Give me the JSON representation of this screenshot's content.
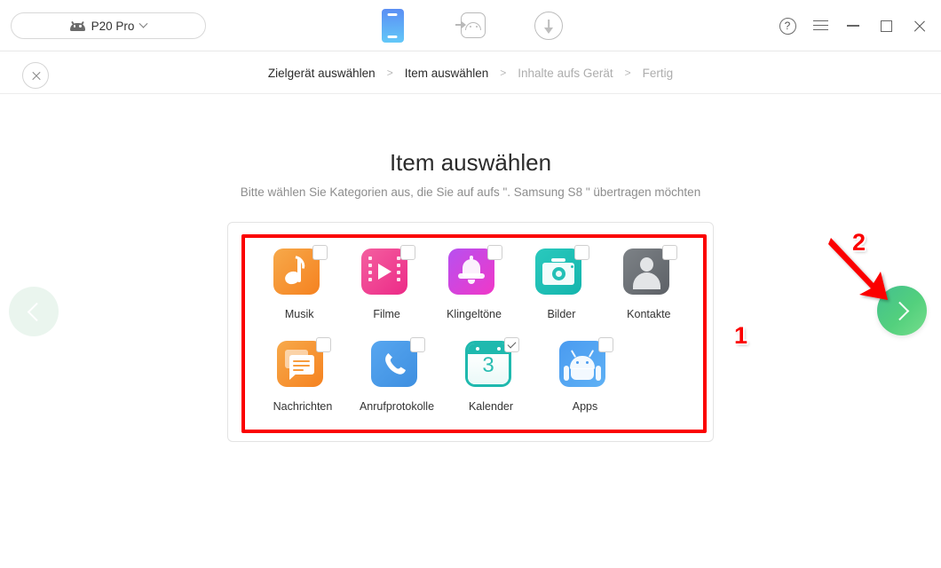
{
  "titlebar": {
    "device": {
      "name": "P20 Pro",
      "icon": "android-head-icon",
      "chevron": "chevron-down-icon"
    },
    "tools": [
      {
        "name": "phone-transfer-tool",
        "icon": "phone-icon",
        "active": true
      },
      {
        "name": "android-restore-tool",
        "icon": "android-transfer-icon",
        "active": false
      },
      {
        "name": "download-tool",
        "icon": "download-circle-icon",
        "active": false
      }
    ],
    "window_controls": [
      {
        "name": "help-button",
        "glyph": "?"
      },
      {
        "name": "menu-button",
        "glyph": "≡"
      },
      {
        "name": "minimize-button",
        "glyph": "–"
      },
      {
        "name": "maximize-button",
        "glyph": "□"
      },
      {
        "name": "close-button",
        "glyph": "✕"
      }
    ]
  },
  "breadcrumb": {
    "close_label": "✕",
    "separator": ">",
    "steps": [
      {
        "label": "Zielgerät auswählen",
        "state": "active"
      },
      {
        "label": "Item auswählen",
        "state": "active"
      },
      {
        "label": "Inhalte aufs Gerät",
        "state": "inactive"
      },
      {
        "label": "Fertig",
        "state": "inactive"
      }
    ]
  },
  "main": {
    "title": "Item auswählen",
    "subtitle": "Bitte wählen Sie Kategorien aus, die Sie auf aufs \". Samsung S8 \" übertragen möchten",
    "target_device": "Samsung S8",
    "categories": [
      {
        "label": "Musik",
        "icon": "music-note-icon",
        "checked": false,
        "color": "#f58220"
      },
      {
        "label": "Filme",
        "icon": "film-strip-icon",
        "checked": false,
        "color": "#ec2a87"
      },
      {
        "label": "Klingeltöne",
        "icon": "bell-icon",
        "checked": false,
        "color": "#f038c8"
      },
      {
        "label": "Bilder",
        "icon": "camera-icon",
        "checked": false,
        "color": "#14b5ad"
      },
      {
        "label": "Kontakte",
        "icon": "person-icon",
        "checked": false,
        "color": "#5d6166"
      },
      {
        "label": "Nachrichten",
        "icon": "message-bubble-icon",
        "checked": false,
        "color": "#f58220"
      },
      {
        "label": "Anrufprotokolle",
        "icon": "phone-handset-icon",
        "checked": false,
        "color": "#3e8fe0"
      },
      {
        "label": "Kalender",
        "icon": "calendar-icon",
        "checked": true,
        "color": "#1fb9ae",
        "day": "3"
      },
      {
        "label": "Apps",
        "icon": "android-robot-icon",
        "checked": false,
        "color": "#4a9bf0"
      }
    ]
  },
  "navigation": {
    "prev": {
      "name": "previous-button",
      "icon": "chevron-left-icon",
      "enabled": false
    },
    "next": {
      "name": "next-button",
      "icon": "chevron-right-icon",
      "enabled": true
    }
  },
  "annotations": [
    {
      "label": "1",
      "target": "category-grid"
    },
    {
      "label": "2",
      "target": "next-button"
    }
  ],
  "colors": {
    "annotation_red": "#fb0000",
    "next_green": "#53d07d",
    "active_blue": "#5b8ef4"
  }
}
